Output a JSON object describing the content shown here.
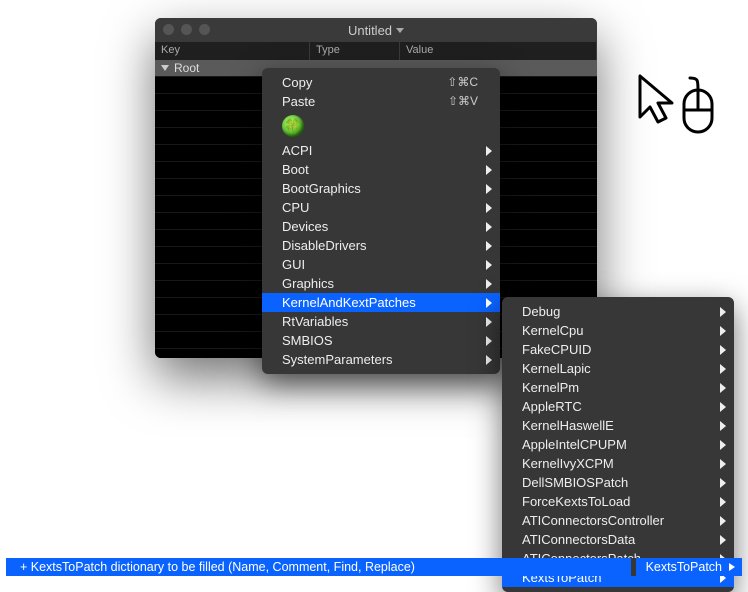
{
  "window": {
    "title": "Untitled",
    "columns": {
      "key": "Key",
      "type": "Type",
      "value": "Value"
    },
    "root_row": {
      "key": "Root",
      "type": "",
      "value": ""
    }
  },
  "menu1": {
    "copy": {
      "label": "Copy",
      "shortcut": "⇧⌘C"
    },
    "paste": {
      "label": "Paste",
      "shortcut": "⇧⌘V"
    },
    "items": [
      "ACPI",
      "Boot",
      "BootGraphics",
      "CPU",
      "Devices",
      "DisableDrivers",
      "GUI",
      "Graphics",
      "KernelAndKextPatches",
      "RtVariables",
      "SMBIOS",
      "SystemParameters"
    ],
    "highlight_index": 8
  },
  "menu2": {
    "items": [
      "Debug",
      "KernelCpu",
      "FakeCPUID",
      "KernelLapic",
      "KernelPm",
      "AppleRTC",
      "KernelHaswellE",
      "AppleIntelCPUPM",
      "KernelIvyXCPM",
      "DellSMBIOSPatch",
      "ForceKextsToLoad",
      "ATIConnectorsController",
      "ATIConnectorsData",
      "ATIConnectorsPatch",
      "KextsToPatch"
    ],
    "highlight_index": 14
  },
  "bottombar": {
    "left_text": "+ KextsToPatch dictionary to be filled (Name, Comment, Find, Replace)",
    "right_text": "KextsToPatch"
  }
}
